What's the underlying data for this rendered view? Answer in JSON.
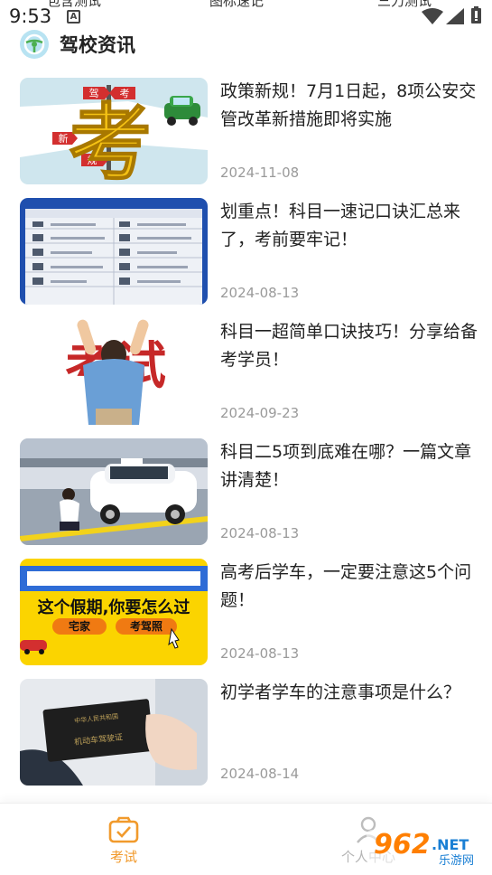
{
  "status_bar": {
    "time": "9:53",
    "top_tabs_partial": [
      "包含测试",
      "图标速记",
      "三力测试"
    ]
  },
  "section": {
    "title": "驾校资讯",
    "icon": "steering-wheel-icon"
  },
  "news": [
    {
      "title": "政策新规！7月1日起，8项公安交管改革新措施即将实施",
      "date": "2024-11-08",
      "thumb": "exam-sign-car-image"
    },
    {
      "title": "划重点！科目一速记口诀汇总来了，考前要牢记！",
      "date": "2024-08-13",
      "thumb": "traffic-signs-chart-image"
    },
    {
      "title": "科目一超简单口诀技巧！分享给备考学员！",
      "date": "2024-09-23",
      "thumb": "exam-cheer-man-image"
    },
    {
      "title": "科目二5项到底难在哪？一篇文章讲清楚！",
      "date": "2024-08-13",
      "thumb": "driving-test-car-image"
    },
    {
      "title": "高考后学车，一定要注意这5个问题！",
      "date": "2024-08-13",
      "thumb": "holiday-banner-image"
    },
    {
      "title": "初学者学车的注意事项是什么？",
      "date": "2024-08-14",
      "thumb": "driver-license-image"
    }
  ],
  "thumb_text": {
    "sign_1": "驾",
    "sign_2": "考",
    "sign_3": "新",
    "sign_4": "规",
    "big_char": "考",
    "cheer_text": "考试",
    "banner_main": "这个假期,你要怎么过",
    "banner_opt1": "宅家",
    "banner_opt2": "考驾照",
    "license_line1": "中华人民共和国",
    "license_line2": "机动车驾驶证"
  },
  "bottom_nav": {
    "tabs": [
      {
        "label": "考试",
        "icon": "exam-checklist-icon",
        "active": true
      },
      {
        "label": "个人中心",
        "icon": "person-icon",
        "active": false
      }
    ]
  },
  "watermark": {
    "main": "962",
    "suffix": ".NET",
    "sub": "乐游网"
  },
  "colors": {
    "accent": "#f19a2c",
    "inactive": "#b5b5b5",
    "date": "#9a9a9a"
  }
}
